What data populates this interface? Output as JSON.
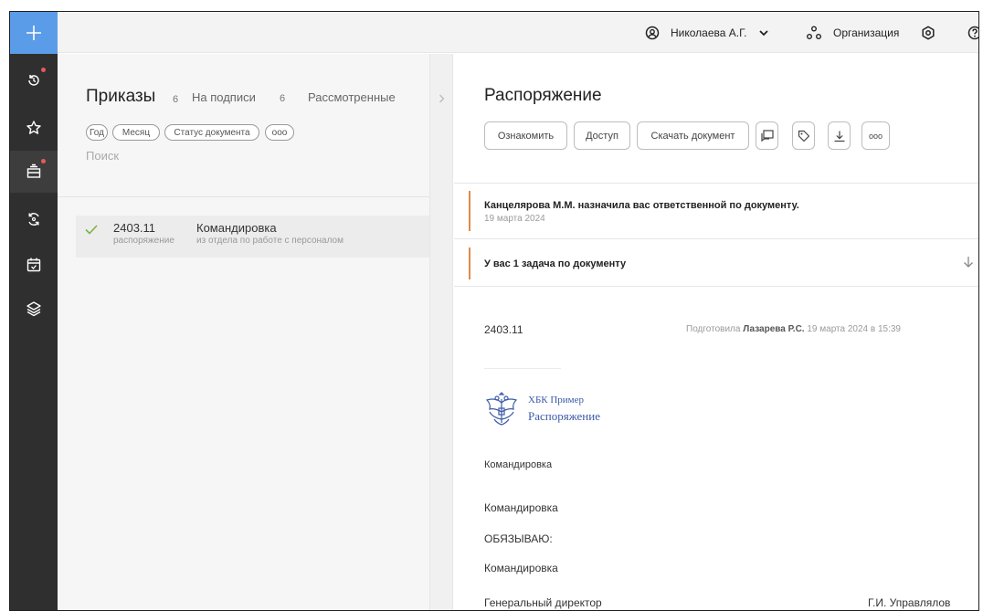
{
  "topbar": {
    "user_name": "Николаева А.Г.",
    "org_label": "Организация"
  },
  "list": {
    "title": "Приказы",
    "title_count": "6",
    "tab_signing": "На подписи",
    "tab_signing_count": "6",
    "tab_reviewed": "Рассмотренные",
    "filters": [
      "Год",
      "Месяц",
      "Статус документа",
      "ооо"
    ],
    "search_placeholder": "Поиск",
    "rows": [
      {
        "number": "2403.11",
        "type": "распоряжение",
        "title": "Командировка",
        "department": "из отдела по работе с персоналом"
      }
    ]
  },
  "doc": {
    "title": "Распоряжение",
    "actions": [
      "Ознакомить",
      "Доступ",
      "Скачать документ"
    ],
    "more_label": "ооо",
    "notice": {
      "text": "Канцелярова М.М. назначила вас ответственной по документу.",
      "date": "19 марта 2024"
    },
    "task_text": "У вас 1 задача по документу",
    "number": "2403.11",
    "prepared_prefix": "Подготовила",
    "prepared_by": "Лазарева Р.С.",
    "prepared_date": "19 марта 2024 в 15:39",
    "org_name": "ХБК Пример",
    "doc_kind": "Распоряжение",
    "subject": "Командировка",
    "body_line": "Командировка",
    "obligates": "ОБЯЗЫВАЮ:",
    "body_line_2": "Командировка",
    "signer_title": "Генеральный директор",
    "signer_name": "Г.И. Управлялов"
  },
  "colors": {
    "rail_bg": "#2f2f2f",
    "accent_blue": "#5b9ce8",
    "notice_orange": "#e08a4c",
    "badge_red": "#e8595a",
    "check_green": "#7cb342"
  }
}
